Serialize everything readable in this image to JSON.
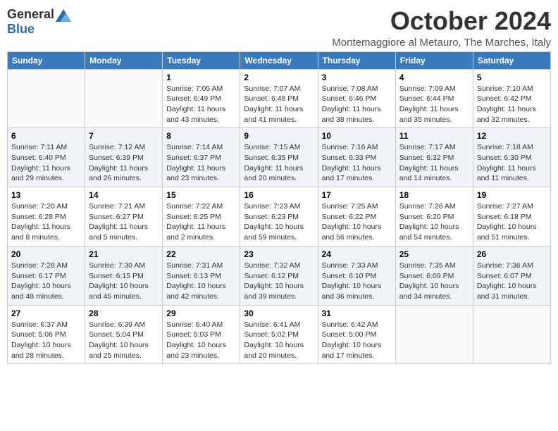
{
  "logo": {
    "general": "General",
    "blue": "Blue"
  },
  "title": "October 2024",
  "location": "Montemaggiore al Metauro, The Marches, Italy",
  "days_of_week": [
    "Sunday",
    "Monday",
    "Tuesday",
    "Wednesday",
    "Thursday",
    "Friday",
    "Saturday"
  ],
  "weeks": [
    [
      {
        "day": "",
        "info": ""
      },
      {
        "day": "",
        "info": ""
      },
      {
        "day": "1",
        "info": "Sunrise: 7:05 AM\nSunset: 6:49 PM\nDaylight: 11 hours and 43 minutes."
      },
      {
        "day": "2",
        "info": "Sunrise: 7:07 AM\nSunset: 6:48 PM\nDaylight: 11 hours and 41 minutes."
      },
      {
        "day": "3",
        "info": "Sunrise: 7:08 AM\nSunset: 6:46 PM\nDaylight: 11 hours and 38 minutes."
      },
      {
        "day": "4",
        "info": "Sunrise: 7:09 AM\nSunset: 6:44 PM\nDaylight: 11 hours and 35 minutes."
      },
      {
        "day": "5",
        "info": "Sunrise: 7:10 AM\nSunset: 6:42 PM\nDaylight: 11 hours and 32 minutes."
      }
    ],
    [
      {
        "day": "6",
        "info": "Sunrise: 7:11 AM\nSunset: 6:40 PM\nDaylight: 11 hours and 29 minutes."
      },
      {
        "day": "7",
        "info": "Sunrise: 7:12 AM\nSunset: 6:39 PM\nDaylight: 11 hours and 26 minutes."
      },
      {
        "day": "8",
        "info": "Sunrise: 7:14 AM\nSunset: 6:37 PM\nDaylight: 11 hours and 23 minutes."
      },
      {
        "day": "9",
        "info": "Sunrise: 7:15 AM\nSunset: 6:35 PM\nDaylight: 11 hours and 20 minutes."
      },
      {
        "day": "10",
        "info": "Sunrise: 7:16 AM\nSunset: 6:33 PM\nDaylight: 11 hours and 17 minutes."
      },
      {
        "day": "11",
        "info": "Sunrise: 7:17 AM\nSunset: 6:32 PM\nDaylight: 11 hours and 14 minutes."
      },
      {
        "day": "12",
        "info": "Sunrise: 7:18 AM\nSunset: 6:30 PM\nDaylight: 11 hours and 11 minutes."
      }
    ],
    [
      {
        "day": "13",
        "info": "Sunrise: 7:20 AM\nSunset: 6:28 PM\nDaylight: 11 hours and 8 minutes."
      },
      {
        "day": "14",
        "info": "Sunrise: 7:21 AM\nSunset: 6:27 PM\nDaylight: 11 hours and 5 minutes."
      },
      {
        "day": "15",
        "info": "Sunrise: 7:22 AM\nSunset: 6:25 PM\nDaylight: 11 hours and 2 minutes."
      },
      {
        "day": "16",
        "info": "Sunrise: 7:23 AM\nSunset: 6:23 PM\nDaylight: 10 hours and 59 minutes."
      },
      {
        "day": "17",
        "info": "Sunrise: 7:25 AM\nSunset: 6:22 PM\nDaylight: 10 hours and 56 minutes."
      },
      {
        "day": "18",
        "info": "Sunrise: 7:26 AM\nSunset: 6:20 PM\nDaylight: 10 hours and 54 minutes."
      },
      {
        "day": "19",
        "info": "Sunrise: 7:27 AM\nSunset: 6:18 PM\nDaylight: 10 hours and 51 minutes."
      }
    ],
    [
      {
        "day": "20",
        "info": "Sunrise: 7:28 AM\nSunset: 6:17 PM\nDaylight: 10 hours and 48 minutes."
      },
      {
        "day": "21",
        "info": "Sunrise: 7:30 AM\nSunset: 6:15 PM\nDaylight: 10 hours and 45 minutes."
      },
      {
        "day": "22",
        "info": "Sunrise: 7:31 AM\nSunset: 6:13 PM\nDaylight: 10 hours and 42 minutes."
      },
      {
        "day": "23",
        "info": "Sunrise: 7:32 AM\nSunset: 6:12 PM\nDaylight: 10 hours and 39 minutes."
      },
      {
        "day": "24",
        "info": "Sunrise: 7:33 AM\nSunset: 6:10 PM\nDaylight: 10 hours and 36 minutes."
      },
      {
        "day": "25",
        "info": "Sunrise: 7:35 AM\nSunset: 6:09 PM\nDaylight: 10 hours and 34 minutes."
      },
      {
        "day": "26",
        "info": "Sunrise: 7:36 AM\nSunset: 6:07 PM\nDaylight: 10 hours and 31 minutes."
      }
    ],
    [
      {
        "day": "27",
        "info": "Sunrise: 6:37 AM\nSunset: 5:06 PM\nDaylight: 10 hours and 28 minutes."
      },
      {
        "day": "28",
        "info": "Sunrise: 6:39 AM\nSunset: 5:04 PM\nDaylight: 10 hours and 25 minutes."
      },
      {
        "day": "29",
        "info": "Sunrise: 6:40 AM\nSunset: 5:03 PM\nDaylight: 10 hours and 23 minutes."
      },
      {
        "day": "30",
        "info": "Sunrise: 6:41 AM\nSunset: 5:02 PM\nDaylight: 10 hours and 20 minutes."
      },
      {
        "day": "31",
        "info": "Sunrise: 6:42 AM\nSunset: 5:00 PM\nDaylight: 10 hours and 17 minutes."
      },
      {
        "day": "",
        "info": ""
      },
      {
        "day": "",
        "info": ""
      }
    ]
  ]
}
